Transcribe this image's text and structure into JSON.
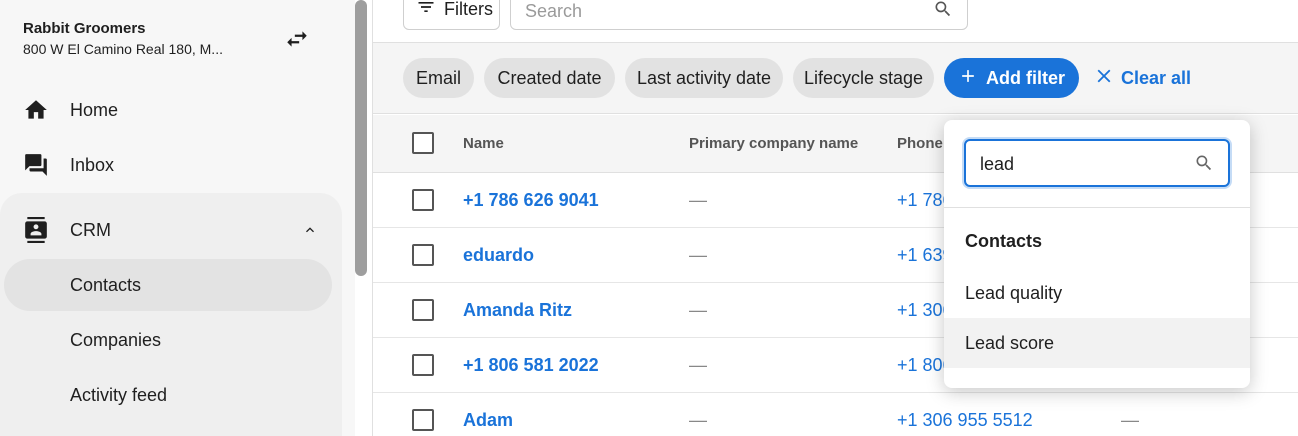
{
  "sidebar": {
    "business_name": "Rabbit Groomers",
    "business_address": "800 W El Camino Real 180, M...",
    "nav": {
      "home": "Home",
      "inbox": "Inbox",
      "crm": "CRM"
    },
    "crm_items": {
      "contacts": "Contacts",
      "companies": "Companies",
      "activity_feed": "Activity feed"
    }
  },
  "toolbar": {
    "filters_label": "Filters",
    "search_placeholder": "Search"
  },
  "chips": {
    "email": "Email",
    "created_date": "Created date",
    "last_activity_date": "Last activity date",
    "lifecycle_stage": "Lifecycle stage"
  },
  "add_filter_label": "Add filter",
  "clear_all_label": "Clear all",
  "table": {
    "headers": {
      "name": "Name",
      "company": "Primary company name",
      "phone": "Phone"
    },
    "rows": [
      {
        "name": "+1 786 626 9041",
        "company": "—",
        "phone": "+1 786",
        "extra": ""
      },
      {
        "name": "eduardo",
        "company": "—",
        "phone": "+1 639",
        "extra": ""
      },
      {
        "name": "Amanda Ritz",
        "company": "—",
        "phone": "+1 306",
        "extra": ""
      },
      {
        "name": "+1 806 581 2022",
        "company": "—",
        "phone": "+1 806",
        "extra": ""
      },
      {
        "name": "Adam",
        "company": "—",
        "phone": "+1 306 955 5512",
        "extra": "—"
      }
    ]
  },
  "dropdown": {
    "search_value": "lead",
    "section": "Contacts",
    "items": [
      "Lead quality",
      "Lead score"
    ]
  },
  "colors": {
    "accent": "#1a73d9"
  }
}
